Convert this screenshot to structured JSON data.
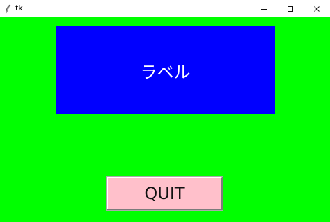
{
  "window": {
    "title": "tk",
    "background_color": "#00ff00"
  },
  "title_bar": {
    "app_icon": "feather-icon",
    "controls": {
      "minimize_icon": "minimize-icon",
      "maximize_icon": "maximize-icon",
      "close_icon": "close-icon"
    }
  },
  "main": {
    "label": {
      "text": "ラベル",
      "background_color": "#0000ff",
      "text_color": "#ffffff"
    },
    "quit_button": {
      "label": "QUIT",
      "background_color": "#ffc0cb"
    }
  }
}
